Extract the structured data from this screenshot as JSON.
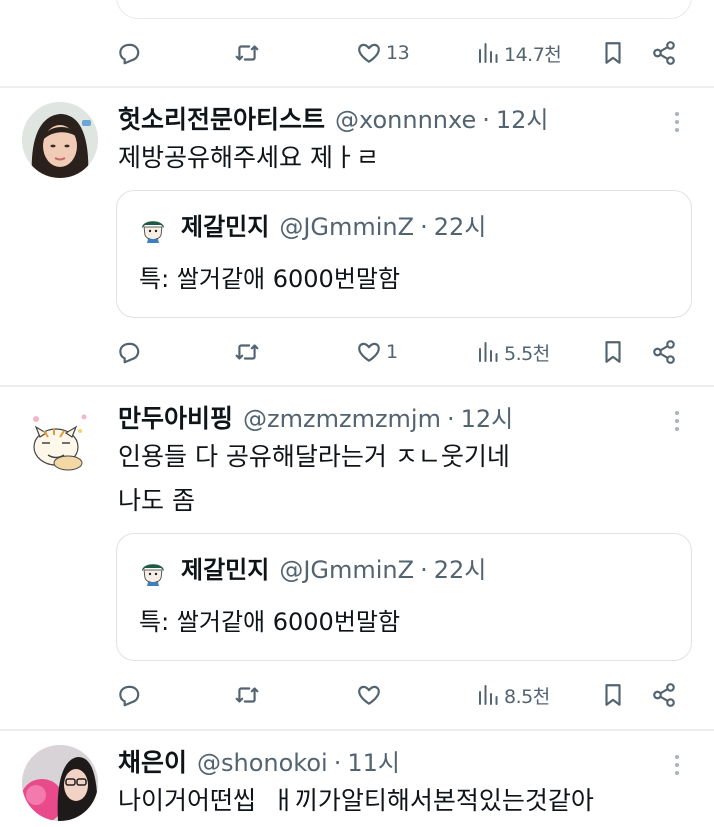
{
  "colors": {
    "text": "#0f1419",
    "muted": "#536471",
    "border": "#dfe3e7",
    "divider": "#eceef0"
  },
  "tweets": [
    {
      "actions": {
        "reply": "",
        "retweet": "",
        "like": "13",
        "views": "14.7천"
      }
    },
    {
      "name": "헛소리전문아티스트",
      "handle": "@xonnnnxe",
      "dot": "·",
      "time": "12시",
      "text": "제방공유해주세요 제ㅏㄹ",
      "quote": {
        "name": "제갈민지",
        "handle": "@JGmminZ",
        "dot": "·",
        "time": "22시",
        "text": "특: 쌀거같애 6000번말함"
      },
      "actions": {
        "reply": "",
        "retweet": "",
        "like": "1",
        "views": "5.5천"
      }
    },
    {
      "name": "만두아비핑",
      "handle": "@zmzmzmzmjm",
      "dot": "·",
      "time": "12시",
      "text_line1": "인용들 다 공유해달라는거 ㅈㄴ웃기네",
      "text_line2": "나도 좀",
      "quote": {
        "name": "제갈민지",
        "handle": "@JGmminZ",
        "dot": "·",
        "time": "22시",
        "text": "특: 쌀거같애 6000번말함"
      },
      "actions": {
        "reply": "",
        "retweet": "",
        "like": "",
        "views": "8.5천"
      }
    },
    {
      "name": "채은이",
      "handle": "@shonokoi",
      "dot": "·",
      "time": "11시",
      "text": "나이거어떤씹  ㅐ끼가알티해서본적있는것같아"
    }
  ],
  "icons": {
    "reply": "reply-icon",
    "retweet": "retweet-icon",
    "like": "heart-icon",
    "views": "views-icon",
    "bookmark": "bookmark-icon",
    "share": "share-icon",
    "more": "more-icon"
  }
}
